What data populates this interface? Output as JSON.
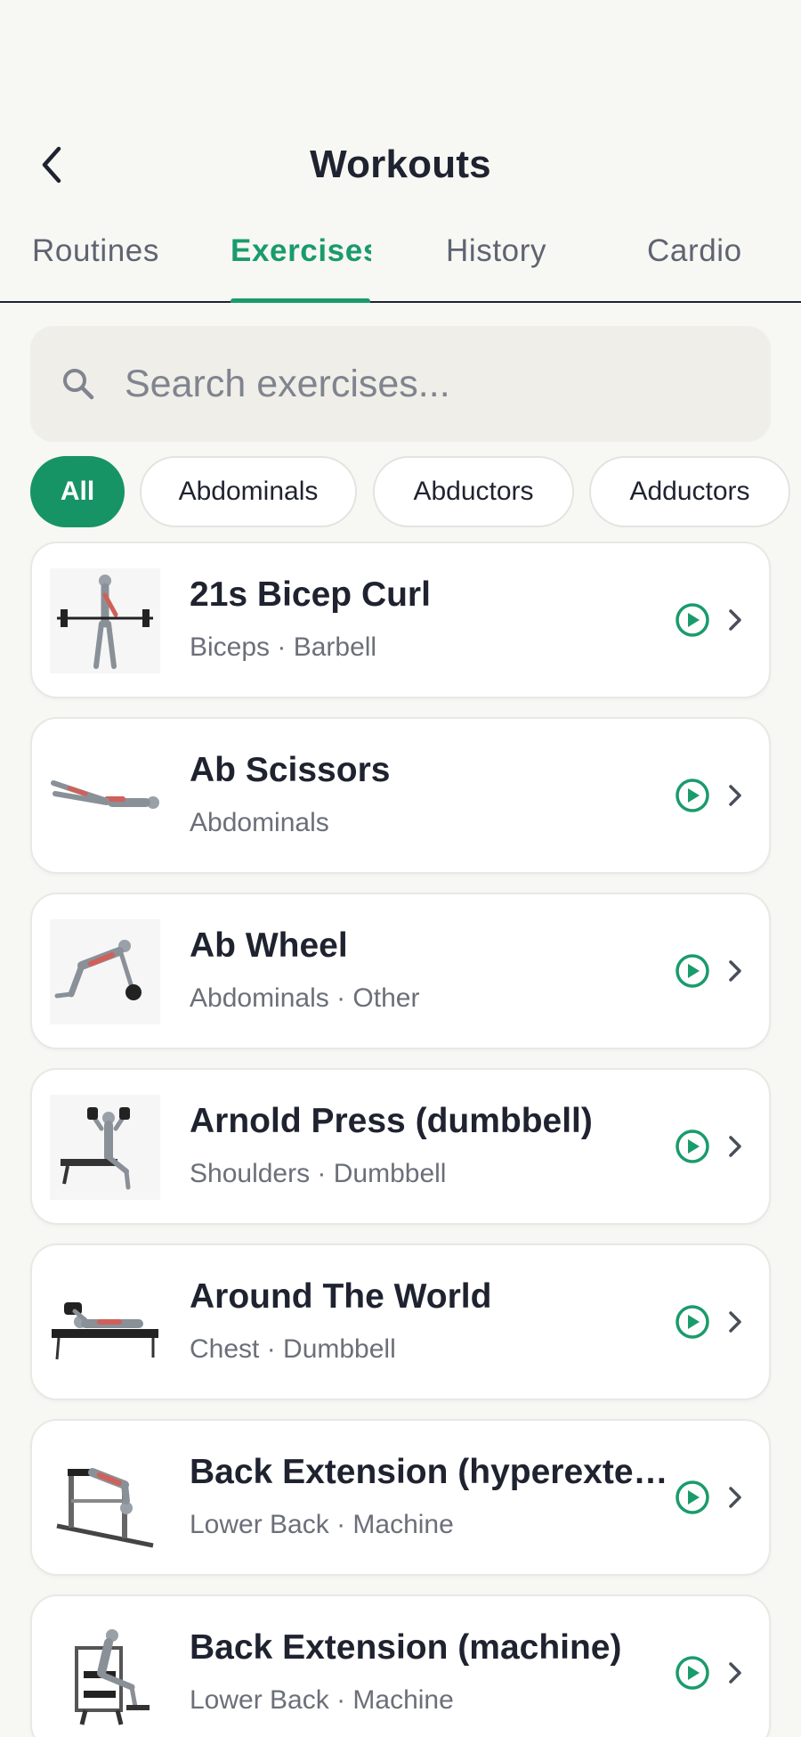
{
  "header": {
    "title": "Workouts"
  },
  "tabs": [
    {
      "label": "Routines"
    },
    {
      "label": "Exercises"
    },
    {
      "label": "History"
    },
    {
      "label": "Cardio"
    }
  ],
  "search": {
    "placeholder": "Search exercises..."
  },
  "filters": [
    {
      "label": "All",
      "selected": true
    },
    {
      "label": "Abdominals",
      "selected": false
    },
    {
      "label": "Abductors",
      "selected": false
    },
    {
      "label": "Adductors",
      "selected": false
    }
  ],
  "exercises": [
    {
      "name": "21s Bicep Curl",
      "detail": "Biceps · Barbell"
    },
    {
      "name": "Ab Scissors",
      "detail": "Abdominals"
    },
    {
      "name": "Ab Wheel",
      "detail": "Abdominals · Other"
    },
    {
      "name": "Arnold Press (dumbbell)",
      "detail": "Shoulders · Dumbbell"
    },
    {
      "name": "Around The World",
      "detail": "Chest · Dumbbell"
    },
    {
      "name": "Back Extension (hyperextension)",
      "detail": "Lower Back · Machine"
    },
    {
      "name": "Back Extension (machine)",
      "detail": "Lower Back · Machine"
    }
  ],
  "colors": {
    "accent": "#1a9b6c",
    "background": "#f7f7f4",
    "text": "#1f2330"
  },
  "icons": {
    "back": "chevron-left-icon",
    "search": "magnifier-icon",
    "play": "play-circle-icon",
    "row": "chevron-right-icon"
  }
}
